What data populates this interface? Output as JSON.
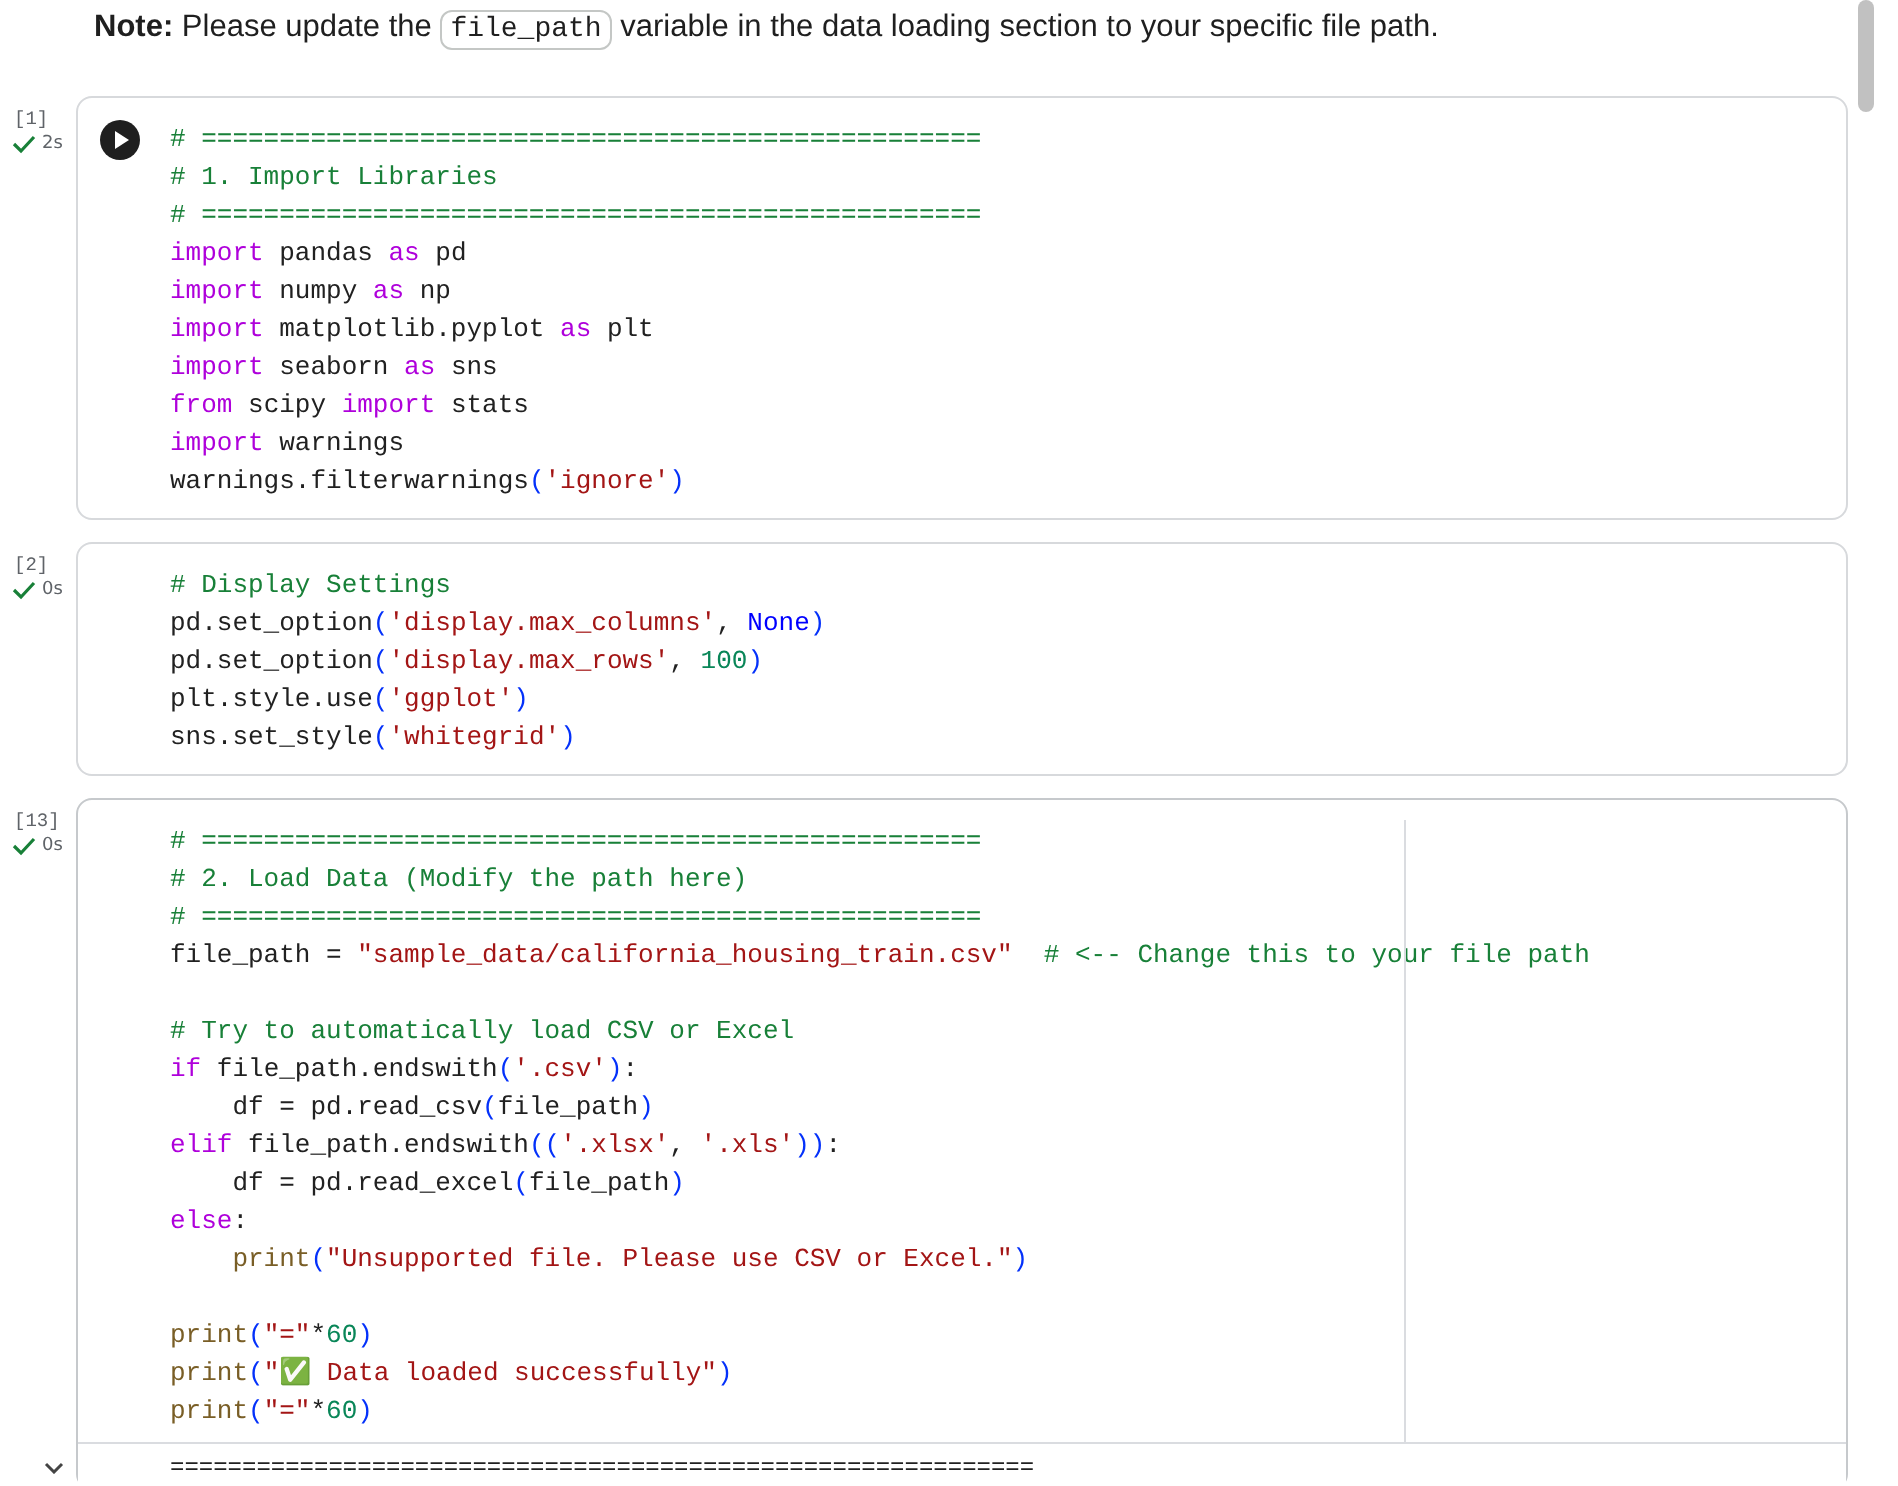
{
  "note": {
    "lead": "**Note:** Please update the",
    "code": "file_path",
    "tail": "variable in the data loading section to your specific file path."
  },
  "cells": [
    {
      "count": "[1]",
      "done": true,
      "time": "2s",
      "show_run_button": true,
      "editing": false,
      "blocks": [
        [
          [
            {
              "kind": "comment",
              "text": "# =================================================="
            }
          ],
          [
            {
              "kind": "comment",
              "text": "# 1. Import Libraries"
            }
          ],
          [
            {
              "kind": "comment",
              "text": "# =================================================="
            }
          ],
          [
            {
              "kind": "keyword",
              "text": "import"
            },
            {
              "kind": "plain",
              "text": " pandas "
            },
            {
              "kind": "keyword",
              "text": "as"
            },
            {
              "kind": "plain",
              "text": " pd"
            }
          ],
          [
            {
              "kind": "keyword",
              "text": "import"
            },
            {
              "kind": "plain",
              "text": " numpy "
            },
            {
              "kind": "keyword",
              "text": "as"
            },
            {
              "kind": "plain",
              "text": " np"
            }
          ],
          [
            {
              "kind": "keyword",
              "text": "import"
            },
            {
              "kind": "plain",
              "text": " matplotlib.pyplot "
            },
            {
              "kind": "keyword",
              "text": "as"
            },
            {
              "kind": "plain",
              "text": " plt"
            }
          ],
          [
            {
              "kind": "keyword",
              "text": "import"
            },
            {
              "kind": "plain",
              "text": " seaborn "
            },
            {
              "kind": "keyword",
              "text": "as"
            },
            {
              "kind": "plain",
              "text": " sns"
            }
          ],
          [
            {
              "kind": "keyword",
              "text": "from"
            },
            {
              "kind": "plain",
              "text": " scipy "
            },
            {
              "kind": "keyword",
              "text": "import"
            },
            {
              "kind": "plain",
              "text": " stats"
            }
          ],
          [
            {
              "kind": "keyword",
              "text": "import"
            },
            {
              "kind": "plain",
              "text": " warnings"
            }
          ],
          [
            {
              "kind": "plain",
              "text": "warnings.filterwarnings"
            },
            {
              "kind": "bracket",
              "text": "("
            },
            {
              "kind": "string",
              "text": "'ignore'"
            },
            {
              "kind": "bracket",
              "text": ")"
            }
          ]
        ]
      ]
    },
    {
      "count": "[2]",
      "done": true,
      "time": "0s",
      "show_run_button": false,
      "editing": false,
      "blocks": [
        [
          [
            {
              "kind": "comment",
              "text": "# Display Settings"
            }
          ],
          [
            {
              "kind": "plain",
              "text": "pd.set_option"
            },
            {
              "kind": "bracket",
              "text": "("
            },
            {
              "kind": "string",
              "text": "'display.max_columns'"
            },
            {
              "kind": "plain",
              "text": ", "
            },
            {
              "kind": "constant",
              "text": "None"
            },
            {
              "kind": "bracket",
              "text": ")"
            }
          ],
          [
            {
              "kind": "plain",
              "text": "pd.set_option"
            },
            {
              "kind": "bracket",
              "text": "("
            },
            {
              "kind": "string",
              "text": "'display.max_rows'"
            },
            {
              "kind": "plain",
              "text": ", "
            },
            {
              "kind": "number",
              "text": "100"
            },
            {
              "kind": "bracket",
              "text": ")"
            }
          ],
          [
            {
              "kind": "plain",
              "text": "plt.style.use"
            },
            {
              "kind": "bracket",
              "text": "("
            },
            {
              "kind": "string",
              "text": "'ggplot'"
            },
            {
              "kind": "bracket",
              "text": ")"
            }
          ],
          [
            {
              "kind": "plain",
              "text": "sns.set_style"
            },
            {
              "kind": "bracket",
              "text": "("
            },
            {
              "kind": "string",
              "text": "'whitegrid'"
            },
            {
              "kind": "bracket",
              "text": ")"
            }
          ]
        ]
      ]
    },
    {
      "count": "[13]",
      "done": true,
      "time": "0s",
      "show_run_button": false,
      "editing": true,
      "blocks": [
        [
          [
            {
              "kind": "comment",
              "text": "# =================================================="
            }
          ],
          [
            {
              "kind": "comment",
              "text": "# 2. Load Data (Modify the path here)"
            }
          ],
          [
            {
              "kind": "comment",
              "text": "# =================================================="
            }
          ],
          [
            {
              "kind": "plain",
              "text": "file_path = "
            },
            {
              "kind": "string",
              "text": "\"sample_data/california_housing_train.csv\""
            },
            {
              "kind": "comment",
              "text": "  # <-- Change this to your file path"
            }
          ]
        ],
        [
          [
            {
              "kind": "comment",
              "text": "# Try to automatically load CSV or Excel"
            }
          ],
          [
            {
              "kind": "keyword",
              "text": "if"
            },
            {
              "kind": "plain",
              "text": " file_path.endswith"
            },
            {
              "kind": "bracket",
              "text": "("
            },
            {
              "kind": "string",
              "text": "'.csv'"
            },
            {
              "kind": "bracket",
              "text": ")"
            },
            {
              "kind": "plain",
              "text": ":"
            }
          ],
          [
            {
              "kind": "plain",
              "text": "    df = pd.read_csv"
            },
            {
              "kind": "bracket",
              "text": "("
            },
            {
              "kind": "plain",
              "text": "file_path"
            },
            {
              "kind": "bracket",
              "text": ")"
            }
          ],
          [
            {
              "kind": "keyword",
              "text": "elif"
            },
            {
              "kind": "plain",
              "text": " file_path.endswith"
            },
            {
              "kind": "bracket",
              "text": "(("
            },
            {
              "kind": "string",
              "text": "'.xlsx'"
            },
            {
              "kind": "plain",
              "text": ", "
            },
            {
              "kind": "string",
              "text": "'.xls'"
            },
            {
              "kind": "bracket",
              "text": "))"
            },
            {
              "kind": "plain",
              "text": ":"
            }
          ],
          [
            {
              "kind": "plain",
              "text": "    df = pd.read_excel"
            },
            {
              "kind": "bracket",
              "text": "("
            },
            {
              "kind": "plain",
              "text": "file_path"
            },
            {
              "kind": "bracket",
              "text": ")"
            }
          ],
          [
            {
              "kind": "keyword",
              "text": "else"
            },
            {
              "kind": "plain",
              "text": ":"
            }
          ],
          [
            {
              "kind": "function",
              "text": "    print"
            },
            {
              "kind": "bracket",
              "text": "("
            },
            {
              "kind": "string",
              "text": "\"Unsupported file. Please use CSV or Excel.\""
            },
            {
              "kind": "bracket",
              "text": ")"
            }
          ]
        ],
        [
          [
            {
              "kind": "function",
              "text": "print"
            },
            {
              "kind": "bracket",
              "text": "("
            },
            {
              "kind": "string",
              "text": "\"=\""
            },
            {
              "kind": "plain",
              "text": "*"
            },
            {
              "kind": "number",
              "text": "60"
            },
            {
              "kind": "bracket",
              "text": ")"
            }
          ],
          [
            {
              "kind": "function",
              "text": "print"
            },
            {
              "kind": "bracket",
              "text": "("
            },
            {
              "kind": "string",
              "text": "\"✅ Data loaded successfully\""
            },
            {
              "kind": "bracket",
              "text": ")"
            }
          ],
          [
            {
              "kind": "function",
              "text": "print"
            },
            {
              "kind": "bracket",
              "text": "("
            },
            {
              "kind": "string",
              "text": "\"=\""
            },
            {
              "kind": "plain",
              "text": "*"
            },
            {
              "kind": "number",
              "text": "60"
            },
            {
              "kind": "bracket",
              "text": ")"
            }
          ]
        ]
      ],
      "output": {
        "expanded": true,
        "text": "============================================================"
      }
    }
  ]
}
